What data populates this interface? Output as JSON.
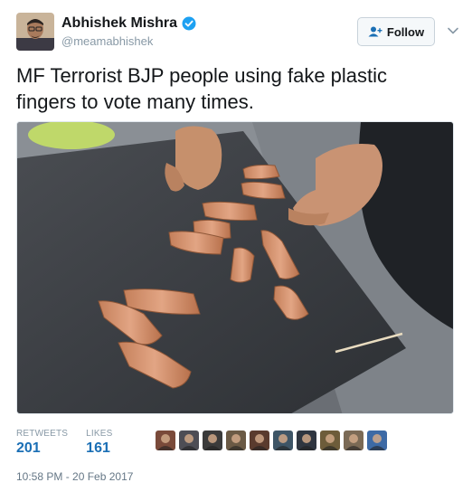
{
  "tweet": {
    "author": {
      "display_name": "Abhishek Mishra",
      "handle": "@meamabhishek",
      "verified": true
    },
    "follow_button": {
      "label": "Follow",
      "icon": "add-user-icon"
    },
    "menu_icon": "chevron-down-icon",
    "text": "MF Terrorist BJP people using fake plastic fingers to vote many times.",
    "stats": {
      "retweets_label": "RETWEETS",
      "retweets_value": "201",
      "likes_label": "LIKES",
      "likes_value": "161"
    },
    "liker_avatar_colors": [
      "#7a4a3a",
      "#4d4d55",
      "#3b3b3b",
      "#6b5a45",
      "#5a3b2e",
      "#3e5566",
      "#2f3640",
      "#6d5c3a",
      "#7b6a55",
      "#3d6aa5"
    ],
    "timestamp": "10:58 PM - 20 Feb 2017"
  },
  "colors": {
    "link_blue": "#1b6fb5",
    "muted": "#8899a6",
    "verified_blue": "#1da1f2"
  }
}
